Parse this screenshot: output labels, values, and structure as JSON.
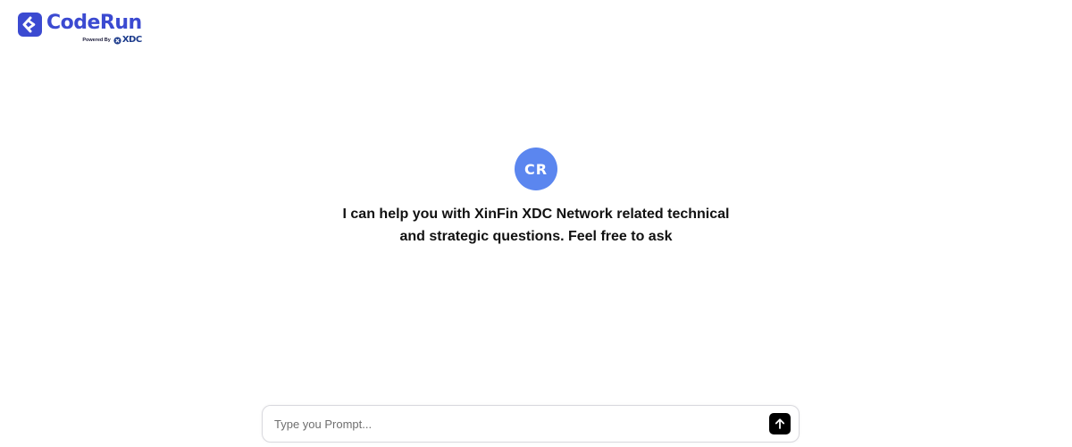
{
  "header": {
    "brand_name": "CodeRun",
    "powered_by_label": "Powered By",
    "partner_name": "XDC"
  },
  "assistant": {
    "avatar_initials": "CR",
    "intro_message": "I can help you with XinFin XDC Network related technical and strategic questions. Feel free to ask"
  },
  "prompt": {
    "placeholder": "Type you Prompt...",
    "value": "",
    "send_icon": "arrow-up-icon"
  },
  "colors": {
    "brand": "#3b4ad1",
    "avatar_bg": "#5b86ef",
    "send_button_bg": "#000000"
  }
}
